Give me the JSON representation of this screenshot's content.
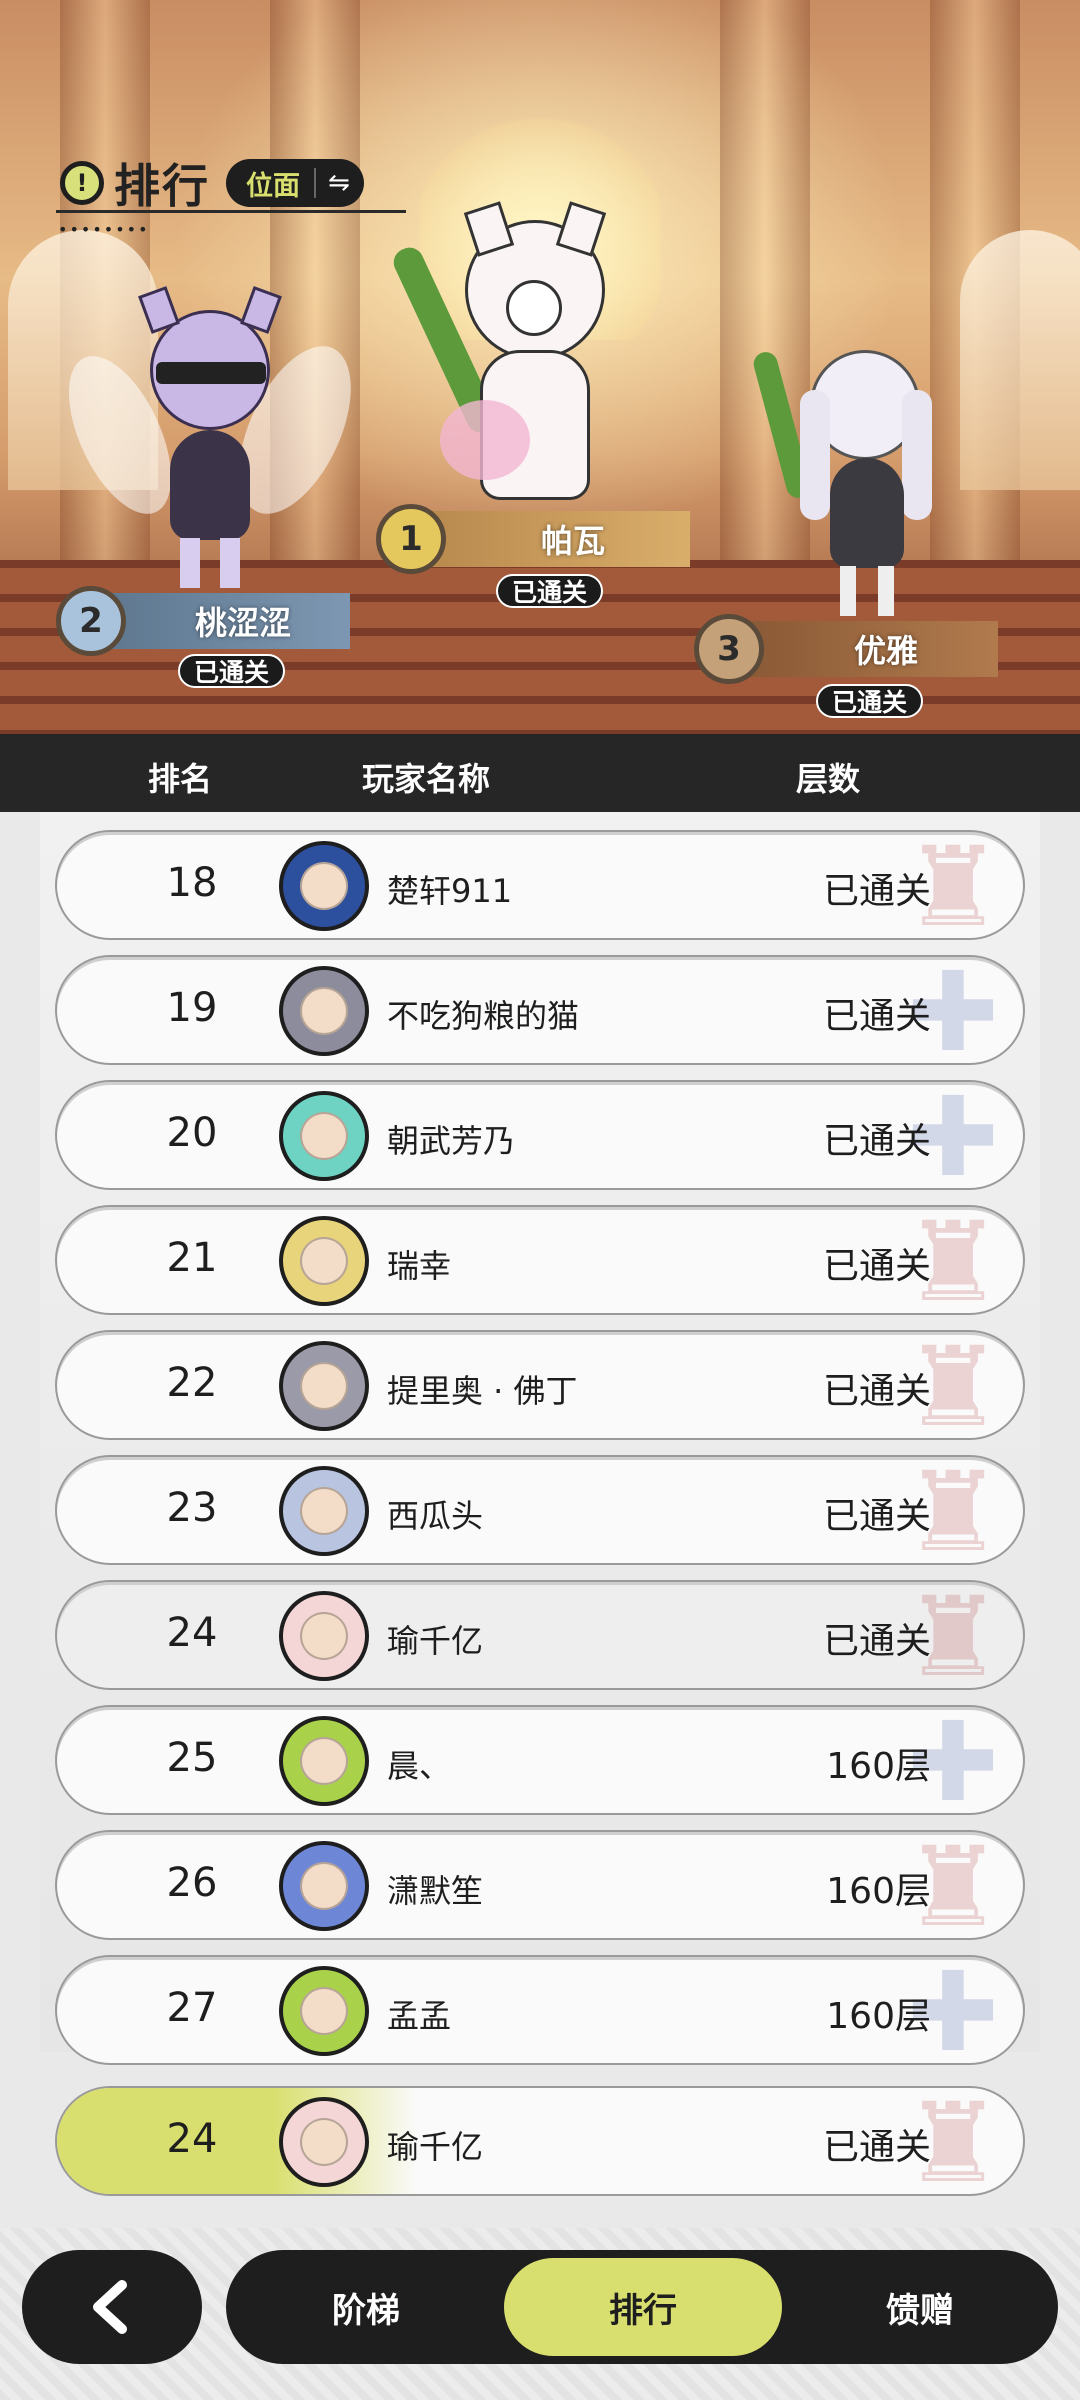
{
  "title": {
    "text": "排行",
    "mode": "位面"
  },
  "podium": [
    {
      "rank": "2",
      "name": "桃涩涩",
      "status": "已通关"
    },
    {
      "rank": "1",
      "name": "帕瓦",
      "status": "已通关"
    },
    {
      "rank": "3",
      "name": "优雅",
      "status": "已通关"
    }
  ],
  "table_header": {
    "rank": "排名",
    "player": "玩家名称",
    "floor": "层数"
  },
  "rows": [
    {
      "rank": "18",
      "name": "楚轩911",
      "floor": "已通关",
      "avatar_color": "#2c4f9e",
      "emblem_color": "#b4464b"
    },
    {
      "rank": "19",
      "name": "不吃狗粮的猫",
      "floor": "已通关",
      "avatar_color": "#8c8c9c",
      "emblem_color": "#4a5fa8"
    },
    {
      "rank": "20",
      "name": "朝武芳乃",
      "floor": "已通关",
      "avatar_color": "#6fd3c3",
      "emblem_color": "#4a5fa8"
    },
    {
      "rank": "21",
      "name": "瑞幸",
      "floor": "已通关",
      "avatar_color": "#e8d47a",
      "emblem_color": "#b4464b"
    },
    {
      "rank": "22",
      "name": "提里奥 · 佛丁",
      "floor": "已通关",
      "avatar_color": "#9a9aa8",
      "emblem_color": "#b4464b"
    },
    {
      "rank": "23",
      "name": "西瓜头",
      "floor": "已通关",
      "avatar_color": "#b9c4e0",
      "emblem_color": "#b4464b"
    },
    {
      "rank": "24",
      "name": "瑜千亿",
      "floor": "已通关",
      "avatar_color": "#f4d6d6",
      "emblem_color": "#b4464b"
    },
    {
      "rank": "25",
      "name": "晨、",
      "floor": "160层",
      "avatar_color": "#a9d24a",
      "emblem_color": "#4a5fa8"
    },
    {
      "rank": "26",
      "name": "潇默笙",
      "floor": "160层",
      "avatar_color": "#6d86d6",
      "emblem_color": "#b4464b"
    },
    {
      "rank": "27",
      "name": "孟孟",
      "floor": "160层",
      "avatar_color": "#a9d24a",
      "emblem_color": "#4a5fa8"
    }
  ],
  "my_row": {
    "rank": "24",
    "name": "瑜千亿",
    "floor": "已通关"
  },
  "tabs": [
    {
      "label": "阶梯",
      "active": false
    },
    {
      "label": "排行",
      "active": true
    },
    {
      "label": "馈赠",
      "active": false
    }
  ],
  "colors": {
    "accent": "#d9df6e",
    "dark": "#1e1e1e"
  },
  "icons": {
    "back": "chevron-left-icon",
    "swap": "swap-icon",
    "alert": "alert-icon"
  }
}
